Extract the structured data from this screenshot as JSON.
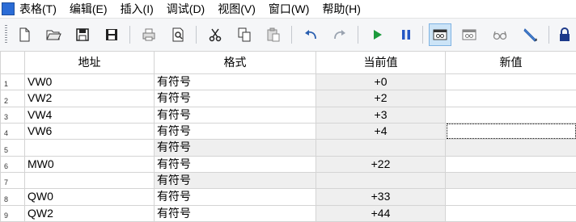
{
  "menu": {
    "items": [
      "表格(T)",
      "编辑(E)",
      "插入(I)",
      "调试(D)",
      "视图(V)",
      "窗口(W)",
      "帮助(H)"
    ]
  },
  "toolbar": {
    "buttons": [
      {
        "name": "new-icon"
      },
      {
        "name": "open-folder-icon"
      },
      {
        "name": "save-icon"
      },
      {
        "name": "save-all-icon"
      },
      {
        "name": "print-icon"
      },
      {
        "name": "print-preview-icon"
      },
      {
        "name": "cut-icon"
      },
      {
        "name": "copy-icon"
      },
      {
        "name": "paste-icon"
      },
      {
        "name": "undo-icon"
      },
      {
        "name": "redo-icon"
      },
      {
        "name": "run-icon"
      },
      {
        "name": "pause-icon"
      },
      {
        "name": "monitor-icon"
      },
      {
        "name": "monitor-single-icon"
      },
      {
        "name": "glasses-icon"
      },
      {
        "name": "force-pen-icon"
      },
      {
        "name": "lock-icon"
      }
    ]
  },
  "table": {
    "headers": [
      "地址",
      "格式",
      "当前值",
      "新值"
    ],
    "rows": [
      {
        "num": "1",
        "address": "VW0",
        "format": "有符号",
        "current": "+0",
        "new": ""
      },
      {
        "num": "2",
        "address": "VW2",
        "format": "有符号",
        "current": "+2",
        "new": ""
      },
      {
        "num": "3",
        "address": "VW4",
        "format": "有符号",
        "current": "+3",
        "new": ""
      },
      {
        "num": "4",
        "address": "VW6",
        "format": "有符号",
        "current": "+4",
        "new": ""
      },
      {
        "num": "5",
        "address": "",
        "format": "有符号",
        "current": "",
        "new": ""
      },
      {
        "num": "6",
        "address": "MW0",
        "format": "有符号",
        "current": "+22",
        "new": ""
      },
      {
        "num": "7",
        "address": "",
        "format": "有符号",
        "current": "",
        "new": ""
      },
      {
        "num": "8",
        "address": "QW0",
        "format": "有符号",
        "current": "+33",
        "new": ""
      },
      {
        "num": "9",
        "address": "QW2",
        "format": "有符号",
        "current": "+44",
        "new": ""
      }
    ]
  }
}
